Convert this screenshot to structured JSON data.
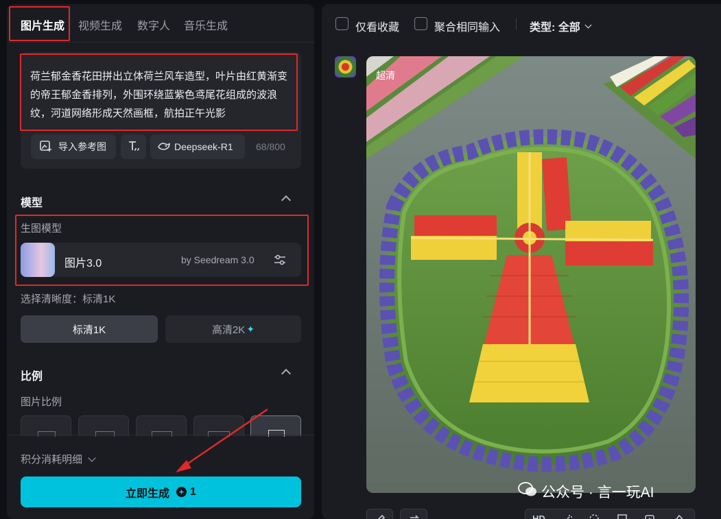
{
  "tabs": [
    {
      "label": "图片生成",
      "active": true
    },
    {
      "label": "视频生成",
      "active": false
    },
    {
      "label": "数字人",
      "active": false
    },
    {
      "label": "音乐生成",
      "active": false
    }
  ],
  "prompt": {
    "text": "荷兰郁金香花田拼出立体荷兰风车造型，叶片由红黄渐变的帝王郁金香排列，外围环绕蓝紫色鸢尾花组成的波浪纹，河道网络形成天然画框，航拍正午光影",
    "import_ref_label": "导入参考图",
    "model_chip_label": "Deepseek-R1",
    "char_count": "68/800"
  },
  "model_section": {
    "title": "模型",
    "sub_label": "生图模型",
    "model_name": "图片3.0",
    "model_by": "by Seedream 3.0",
    "resolution_label": "选择清晰度：标清1K",
    "quality_options": [
      {
        "label": "标清1K",
        "selected": true
      },
      {
        "label": "高清2K",
        "selected": false
      }
    ]
  },
  "ratio_section": {
    "title": "比例",
    "sub_label": "图片比例"
  },
  "credits_label": "积分消耗明细",
  "generate": {
    "label": "立即生成",
    "cost": "1"
  },
  "filters": {
    "favorites_label": "仅看收藏",
    "merge_label": "聚合相同输入",
    "type_label": "类型: 全部"
  },
  "result": {
    "badge": "超清"
  },
  "watermark": "公众号 · 言一玩AI",
  "toolbar": {
    "hd_label": "HD"
  },
  "colors": {
    "accent": "#00c2dc",
    "highlight_box": "#e0292b"
  }
}
